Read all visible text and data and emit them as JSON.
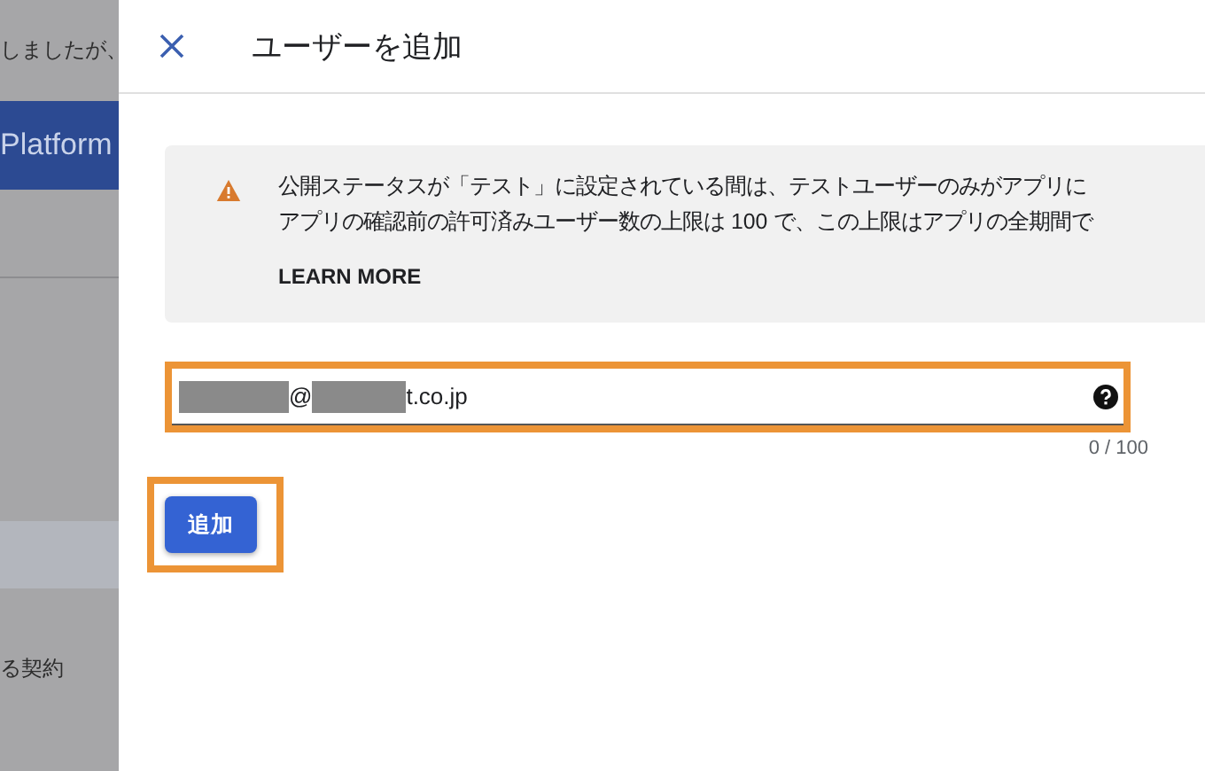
{
  "backdrop": {
    "top_text": "しましたが、",
    "banner_text": "Platform",
    "rows": [
      {
        "label": "",
        "selected": true
      },
      {
        "label": "る契約",
        "selected": false
      }
    ]
  },
  "dialog": {
    "title": "ユーザーを追加",
    "notice": {
      "lines": [
        "公開ステータスが「テスト」に設定されている間は、テストユーザーのみがアプリに",
        "アプリの確認前の許可済みユーザー数の上限は 100 で、この上限はアプリの全期間で"
      ],
      "link": "LEARN MORE"
    },
    "email_field": {
      "highlighted": true,
      "segments": [
        {
          "kind": "redacted"
        },
        {
          "kind": "text",
          "text": "@"
        },
        {
          "kind": "redacted"
        },
        {
          "kind": "text",
          "text": "t.co.jp"
        }
      ],
      "counter": "0 / 100"
    },
    "add_button": {
      "label": "追加",
      "highlighted": true
    }
  }
}
